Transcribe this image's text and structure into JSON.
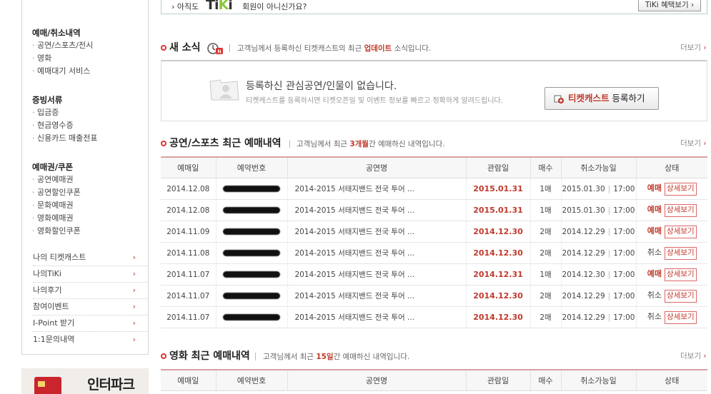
{
  "sidebar": {
    "sections": [
      {
        "heading": "예매/취소내역",
        "items": [
          "공연/스포츠/전시",
          "영화",
          "예매대기 서비스"
        ]
      },
      {
        "heading": "증빙서류",
        "items": [
          "입금증",
          "현금영수증",
          "신용카드 매출전표"
        ]
      },
      {
        "heading": "예매권/쿠폰",
        "items": [
          "공연예매권",
          "공연할인쿠폰",
          "문화예매권",
          "영화예매권",
          "영화할인쿠폰"
        ]
      }
    ],
    "links": [
      "나의 티켓캐스트",
      "나의TiKi",
      "나의후기",
      "참여이벤트",
      "I-Point 받기",
      "1:1문의내역"
    ],
    "arrow": "›",
    "banner_text": "인터파크"
  },
  "tiki_bar": {
    "prefix": "› 아직도",
    "logo_ti": "Ti",
    "logo_k": "K",
    "logo_i": "i",
    "text": "회원이 아니신가요?",
    "button": "TiKi 혜택보기 ›"
  },
  "news": {
    "title": "새 소식",
    "desc_pre": "고객님께서 등록하신 티켓캐스트의 최근",
    "desc_hl": "업데이트",
    "desc_post": "소식입니다.",
    "more": "더보기",
    "empty_main": "등록하신 관심공연/인물이 없습니다.",
    "empty_sub": "티켓캐스트를 등록하시면 티켓오픈일 및 이벤트 정보를 빠르고 정확하게 알려드립니다.",
    "btn_hl": "티켓캐스트",
    "btn_rest": "등록하기"
  },
  "performance": {
    "title": "공연/스포츠 최근 예매내역",
    "desc_pre": "고객님께서 최근",
    "desc_hl": "3개월",
    "desc_post": "간 예매하신 내역입니다.",
    "more": "더보기",
    "headers": [
      "예매일",
      "예약번호",
      "공연명",
      "관람일",
      "매수",
      "취소가능일",
      "상태"
    ],
    "detail_label": "상세보기",
    "rows": [
      {
        "date": "2014.12.08",
        "title": "2014-2015 서태지밴드 전국 투어 ...",
        "view": "2015.01.31",
        "qty": "1매",
        "cancel_date": "2015.01.30",
        "cancel_time": "17:00",
        "status": "예매"
      },
      {
        "date": "2014.12.08",
        "title": "2014-2015 서태지밴드 전국 투어 ...",
        "view": "2015.01.31",
        "qty": "1매",
        "cancel_date": "2015.01.30",
        "cancel_time": "17:00",
        "status": "예매"
      },
      {
        "date": "2014.11.09",
        "title": "2014-2015 서태지밴드 전국 투어 ...",
        "view": "2014.12.30",
        "qty": "2매",
        "cancel_date": "2014.12.29",
        "cancel_time": "17:00",
        "status": "예매"
      },
      {
        "date": "2014.11.08",
        "title": "2014-2015 서태지밴드 전국 투어 ...",
        "view": "2014.12.30",
        "qty": "2매",
        "cancel_date": "2014.12.29",
        "cancel_time": "17:00",
        "status": "취소"
      },
      {
        "date": "2014.11.07",
        "title": "2014-2015 서태지밴드 전국 투어 ...",
        "view": "2014.12.31",
        "qty": "1매",
        "cancel_date": "2014.12.30",
        "cancel_time": "17:00",
        "status": "예매"
      },
      {
        "date": "2014.11.07",
        "title": "2014-2015 서태지밴드 전국 투어 ...",
        "view": "2014.12.30",
        "qty": "2매",
        "cancel_date": "2014.12.29",
        "cancel_time": "17:00",
        "status": "취소"
      },
      {
        "date": "2014.11.07",
        "title": "2014-2015 서태지밴드 전국 투어 ...",
        "view": "2014.12.30",
        "qty": "2매",
        "cancel_date": "2014.12.29",
        "cancel_time": "17:00",
        "status": "취소"
      }
    ]
  },
  "movie": {
    "title": "영화 최근 예매내역",
    "desc_pre": "고객님께서 최근",
    "desc_hl": "15일",
    "desc_post": "간 예매하신 내역입니다.",
    "more": "더보기",
    "headers": [
      "예매일",
      "예약번호",
      "공연명",
      "관람일",
      "매수",
      "취소가능일",
      "상태"
    ]
  }
}
